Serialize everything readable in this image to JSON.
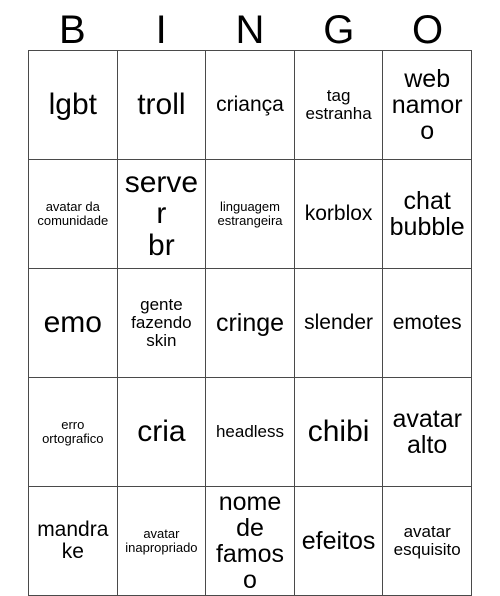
{
  "card": {
    "header_letters": [
      "B",
      "I",
      "N",
      "G",
      "O"
    ],
    "rows": [
      [
        {
          "text": "lgbt",
          "size": "fs-xl"
        },
        {
          "text": "troll",
          "size": "fs-xl"
        },
        {
          "text": "criança",
          "size": "fs-md"
        },
        {
          "text": "tag\nestranha",
          "size": "fs-sm"
        },
        {
          "text": "web\nnamoro",
          "size": "fs-lg"
        }
      ],
      [
        {
          "text": "avatar da\ncomunidade",
          "size": "fs-xs"
        },
        {
          "text": "server\nbr",
          "size": "fs-xl"
        },
        {
          "text": "linguagem\nestrangeira",
          "size": "fs-xs"
        },
        {
          "text": "korblox",
          "size": "fs-md"
        },
        {
          "text": "chat\nbubble",
          "size": "fs-lg"
        }
      ],
      [
        {
          "text": "emo",
          "size": "fs-xl"
        },
        {
          "text": "gente\nfazendo\nskin",
          "size": "fs-sm"
        },
        {
          "text": "cringe",
          "size": "fs-lg"
        },
        {
          "text": "slender",
          "size": "fs-md"
        },
        {
          "text": "emotes",
          "size": "fs-md"
        }
      ],
      [
        {
          "text": "erro\nortografico",
          "size": "fs-xs"
        },
        {
          "text": "cria",
          "size": "fs-xl"
        },
        {
          "text": "headless",
          "size": "fs-sm"
        },
        {
          "text": "chibi",
          "size": "fs-xl"
        },
        {
          "text": "avatar\nalto",
          "size": "fs-lg"
        }
      ],
      [
        {
          "text": "mandrake",
          "size": "fs-md"
        },
        {
          "text": "avatar\ninapropriado",
          "size": "fs-xs"
        },
        {
          "text": "nome\nde\nfamoso",
          "size": "fs-lg"
        },
        {
          "text": "efeitos",
          "size": "fs-lg"
        },
        {
          "text": "avatar\nesquisito",
          "size": "fs-sm"
        }
      ]
    ]
  },
  "colors": {
    "background": "#ffffff",
    "text": "#000000",
    "grid_line": "#4a4a4a"
  }
}
